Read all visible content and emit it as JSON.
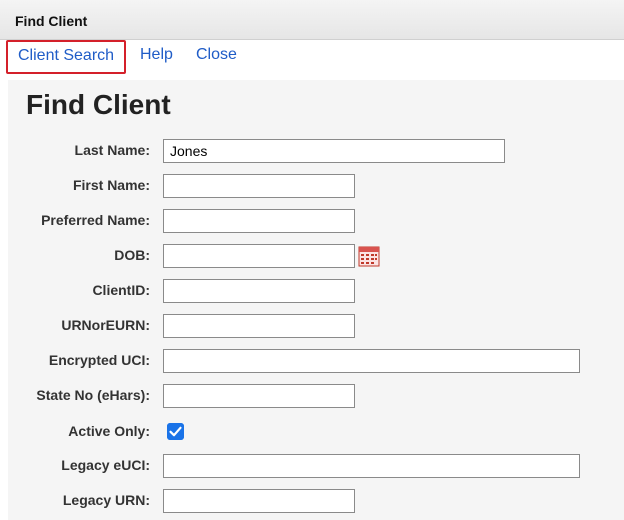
{
  "window": {
    "title": "Find Client"
  },
  "menu": {
    "client_search": "Client Search",
    "help": "Help",
    "close": "Close"
  },
  "page": {
    "heading": "Find Client"
  },
  "form": {
    "last_name": {
      "label": "Last Name:",
      "value": "Jones"
    },
    "first_name": {
      "label": "First Name:",
      "value": ""
    },
    "preferred_name": {
      "label": "Preferred Name:",
      "value": ""
    },
    "dob": {
      "label": "DOB:",
      "value": ""
    },
    "client_id": {
      "label": "ClientID:",
      "value": ""
    },
    "urn_or_eurn": {
      "label": "URNorEURN:",
      "value": ""
    },
    "encrypted_uci": {
      "label": "Encrypted UCI:",
      "value": ""
    },
    "state_no": {
      "label": "State No (eHars):",
      "value": ""
    },
    "active_only": {
      "label": "Active Only:",
      "checked": true
    },
    "legacy_euci": {
      "label": "Legacy eUCI:",
      "value": ""
    },
    "legacy_urn": {
      "label": "Legacy URN:",
      "value": ""
    }
  },
  "icons": {
    "calendar": "calendar-icon",
    "checkbox": "checkmark-icon"
  },
  "colors": {
    "link": "#1f5cc7",
    "highlight_border": "#d4202a",
    "checkbox": "#1a73e8"
  }
}
